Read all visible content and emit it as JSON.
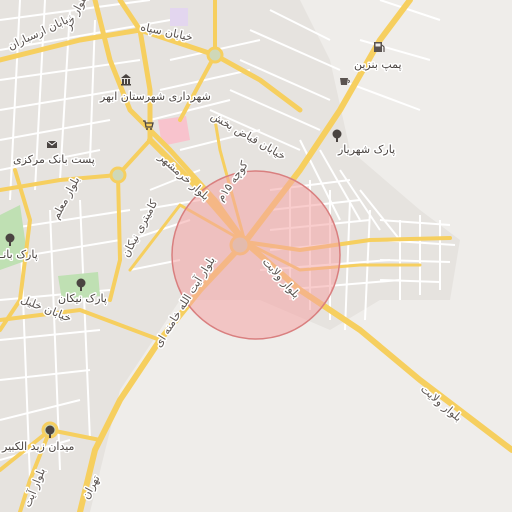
{
  "map": {
    "colors": {
      "land": "#efedea",
      "urban": "#e6e3df",
      "minor_road": "#ffffff",
      "major_road": "#f6cf5f",
      "park": "#bfe0b3",
      "hospital": "#f8c3cd",
      "overlay_fill": "#f4a4a4",
      "overlay_stroke": "#d97f7f"
    },
    "labels": {
      "park_shahriar": "پارک شهریار",
      "gas_station": "پمپ بنزین",
      "khiaban_sepah": "خیابان سپاه",
      "khiaban_arasbaran": "خیابان ارسباران",
      "bolvar_top": "بلوار خر",
      "shahrdari": "شهرداری شهرستان ابهر",
      "bank": "پست بانک مرکزی",
      "faiz_bakhsh": "خیابان فیاض بخش",
      "khorramshahr": "بلوار خرمشهر",
      "kooche_15": "کوچه ۱۵م",
      "shahid_tondgooyan": "کامیتری نیکان",
      "bolvar_moallem": "بلوار معلم",
      "park_ban": "پارک بانـ",
      "park_nikan": "پارک نیکان",
      "khiaban_khalil": "خیابان خلیل",
      "ayatollah_khamenei": "بلوار آیت الله خامنه ای",
      "bolvar_velayat": "بلوار ولایت",
      "bolvar_velayat_2": "بلوار ولایت",
      "meydan_zeid": "میدان زید الکبیر",
      "bolvar_ayat": "بلوار آیت",
      "tehran": "تهران"
    },
    "icons": [
      "gas-station-icon",
      "cafe-icon",
      "tree-icon",
      "bank-icon",
      "mail-icon",
      "shop-icon"
    ]
  }
}
